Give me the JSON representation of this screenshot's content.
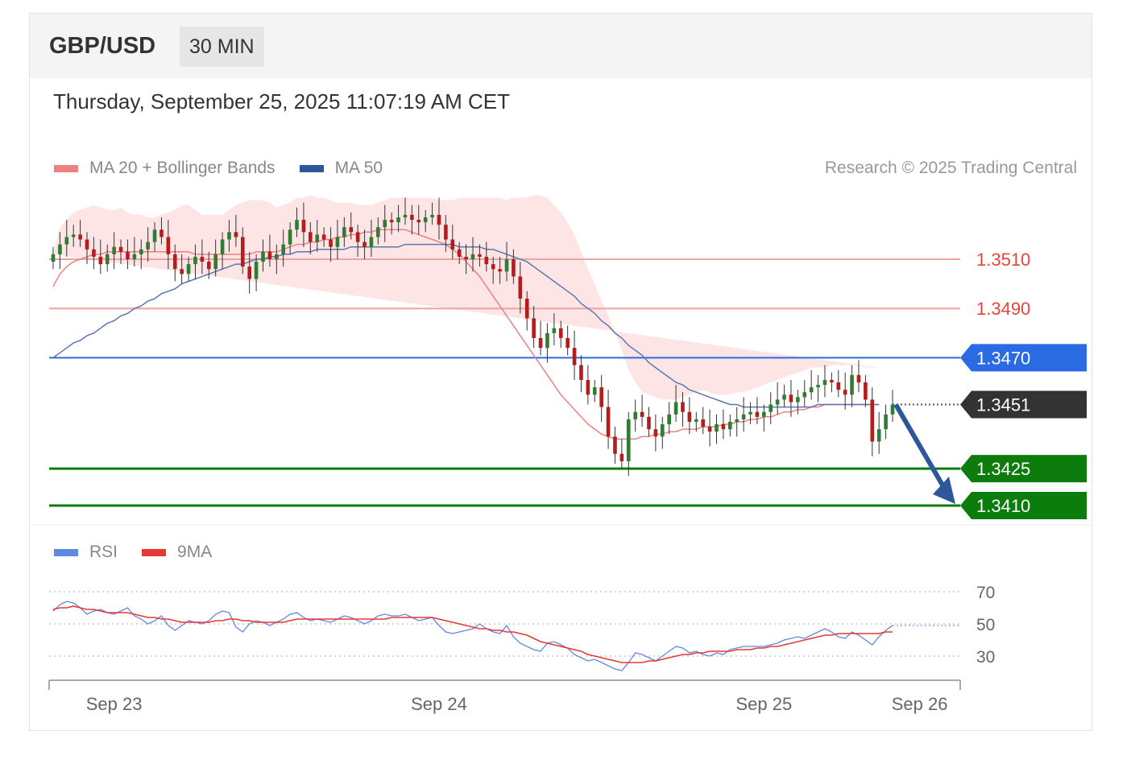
{
  "header": {
    "pair": "GBP/USD",
    "timeframe": "30 MIN"
  },
  "datetime": "Thursday, September 25, 2025 11:07:19 AM CET",
  "legend": {
    "ma20_bb": "MA 20 + Bollinger Bands",
    "ma50": "MA 50",
    "rsi": "RSI",
    "rsi_ma": "9MA"
  },
  "copyright": "Research © 2025 Trading Central",
  "colors": {
    "band_fill": "#fde0e0",
    "ma20": "#f08080",
    "ma50": "#5a77b0",
    "up": "#2e7d32",
    "down": "#b71c1c",
    "resistance": "#e8443a",
    "pivot": "#2a6be4",
    "support": "#0c7d0c",
    "last": "#333333",
    "arrow": "#2c5899",
    "rsi": "#6088e0",
    "rsi_ma": "#e53935"
  },
  "chart_data": {
    "type": "candlestick",
    "ylim": [
      1.3395,
      1.3545
    ],
    "x_labels": [
      {
        "label": "Sep 23",
        "index": 9
      },
      {
        "label": "Sep 24",
        "index": 57
      },
      {
        "label": "Sep 25",
        "index": 105
      },
      {
        "label": "Sep 26",
        "index": 128
      }
    ],
    "levels": [
      {
        "value": 1.351,
        "label": "1.3510",
        "kind": "resistance"
      },
      {
        "value": 1.349,
        "label": "1.3490",
        "kind": "resistance"
      },
      {
        "value": 1.347,
        "label": "1.3470",
        "kind": "pivot"
      },
      {
        "value": 1.3451,
        "label": "1.3451",
        "kind": "last"
      },
      {
        "value": 1.3425,
        "label": "1.3425",
        "kind": "support"
      },
      {
        "value": 1.341,
        "label": "1.3410",
        "kind": "support"
      }
    ],
    "forecast_target": 1.341,
    "closes": [
      1.3512,
      1.3516,
      1.3519,
      1.352,
      1.3518,
      1.3514,
      1.3511,
      1.3508,
      1.3512,
      1.3515,
      1.3513,
      1.351,
      1.3512,
      1.3514,
      1.3517,
      1.3522,
      1.3519,
      1.3512,
      1.3506,
      1.3504,
      1.3508,
      1.3511,
      1.3509,
      1.3506,
      1.3512,
      1.3518,
      1.3521,
      1.3519,
      1.3507,
      1.3502,
      1.3509,
      1.3513,
      1.351,
      1.3512,
      1.3516,
      1.3522,
      1.3526,
      1.3521,
      1.3517,
      1.352,
      1.3518,
      1.3515,
      1.3519,
      1.3523,
      1.3521,
      1.3517,
      1.3515,
      1.3519,
      1.3523,
      1.3526,
      1.3525,
      1.3527,
      1.3528,
      1.3526,
      1.3525,
      1.3527,
      1.3528,
      1.3524,
      1.3518,
      1.3514,
      1.3511,
      1.351,
      1.3512,
      1.3511,
      1.3508,
      1.3506,
      1.3505,
      1.351,
      1.3503,
      1.3494,
      1.3486,
      1.3478,
      1.3474,
      1.348,
      1.3482,
      1.3478,
      1.3474,
      1.3467,
      1.3461,
      1.3455,
      1.3458,
      1.345,
      1.3438,
      1.3431,
      1.3428,
      1.3445,
      1.3448,
      1.3446,
      1.3441,
      1.3438,
      1.3443,
      1.3447,
      1.3452,
      1.3448,
      1.3444,
      1.3445,
      1.3442,
      1.344,
      1.3443,
      1.3441,
      1.3444,
      1.3445,
      1.3447,
      1.3448,
      1.3446,
      1.3448,
      1.3451,
      1.3453,
      1.3455,
      1.3452,
      1.3454,
      1.3456,
      1.3458,
      1.3459,
      1.3461,
      1.346,
      1.3457,
      1.3455,
      1.3463,
      1.346,
      1.3453,
      1.3436,
      1.3441,
      1.3447,
      1.3451
    ],
    "bollinger": {
      "upper": [
        1.3512,
        1.3523,
        1.3526,
        1.3529,
        1.353,
        1.3531,
        1.3532,
        1.3531,
        1.353,
        1.353,
        1.3531,
        1.3529,
        1.3528,
        1.3528,
        1.3527,
        1.3527,
        1.3528,
        1.3529,
        1.353,
        1.3532,
        1.3532,
        1.353,
        1.3528,
        1.3528,
        1.3528,
        1.3528,
        1.353,
        1.3532,
        1.3533,
        1.3534,
        1.3534,
        1.3534,
        1.3533,
        1.3531,
        1.3532,
        1.3533,
        1.3535,
        1.3535,
        1.3536,
        1.3535,
        1.3535,
        1.3534,
        1.3533,
        1.3533,
        1.3533,
        1.3532,
        1.3532,
        1.3532,
        1.3533,
        1.3534,
        1.3535,
        1.3535,
        1.3535,
        1.3535,
        1.3535,
        1.3535,
        1.3535,
        1.3534,
        1.3534,
        1.3534,
        1.3535,
        1.3535,
        1.3535,
        1.3535,
        1.3535,
        1.3535,
        1.3535,
        1.3534,
        1.3535,
        1.3535,
        1.3535,
        1.3536,
        1.3536,
        1.3535,
        1.3532,
        1.3529,
        1.3525,
        1.352,
        1.3513,
        1.3506,
        1.35,
        1.3493,
        1.3487,
        1.348,
        1.3473,
        1.3465,
        1.346,
        1.3456,
        1.3455,
        1.3454,
        1.3453,
        1.3453,
        1.3453,
        1.3454,
        1.3455,
        1.3456,
        1.3457,
        1.3456,
        1.3455,
        1.3455,
        1.3455,
        1.3456,
        1.3456,
        1.3457,
        1.3458,
        1.3459,
        1.346,
        1.3461,
        1.3462,
        1.3463,
        1.3464,
        1.3465,
        1.3466,
        1.3466,
        1.3466,
        1.3467,
        1.3467,
        1.3467,
        1.3467,
        1.3467,
        1.3466,
        1.3466,
        1.3466
      ],
      "lower": [
        1.349,
        1.3494,
        1.3496,
        1.3498,
        1.35,
        1.3501,
        1.3502,
        1.3502,
        1.3503,
        1.3503,
        1.3503,
        1.3502,
        1.3501,
        1.35,
        1.3499,
        1.3497,
        1.3497,
        1.3497,
        1.3496,
        1.3496,
        1.3495,
        1.3495,
        1.3495,
        1.3495,
        1.3495,
        1.3496,
        1.3496,
        1.3496,
        1.3497,
        1.3497,
        1.3497,
        1.3498,
        1.3498,
        1.3499,
        1.35,
        1.3502,
        1.3502,
        1.3502,
        1.3502,
        1.3503,
        1.3504,
        1.3505,
        1.3506,
        1.3507,
        1.3508,
        1.3509,
        1.351,
        1.3511,
        1.3511,
        1.3512,
        1.3512,
        1.3512,
        1.3512,
        1.3511,
        1.3508,
        1.3505,
        1.3502,
        1.35,
        1.3497,
        1.3493,
        1.3489,
        1.3485,
        1.348,
        1.3474,
        1.3468,
        1.3462,
        1.3456,
        1.3451,
        1.3447,
        1.3442,
        1.3437,
        1.3432,
        1.3427,
        1.3423,
        1.342,
        1.3418,
        1.3416,
        1.3415,
        1.3415,
        1.3415,
        1.3415,
        1.3415,
        1.3415,
        1.3416,
        1.3417,
        1.3418,
        1.3419,
        1.342,
        1.3421,
        1.3423,
        1.3424,
        1.3425,
        1.3426,
        1.3426,
        1.3427,
        1.3427,
        1.3428,
        1.3429,
        1.343,
        1.3431,
        1.3432,
        1.3432,
        1.3433,
        1.3433,
        1.3434,
        1.3434,
        1.3434,
        1.3435,
        1.3435,
        1.3435,
        1.3436,
        1.3436,
        1.3436,
        1.3436,
        1.3436,
        1.3436,
        1.3436,
        1.3436,
        1.3436,
        1.3436,
        1.3436,
        1.3436,
        1.3436
      ]
    },
    "ma20": [
      1.3499,
      1.3504,
      1.3507,
      1.3509,
      1.351,
      1.3511,
      1.3512,
      1.3512,
      1.3513,
      1.3513,
      1.3513,
      1.3513,
      1.3513,
      1.3513,
      1.3513,
      1.3513,
      1.3513,
      1.3513,
      1.3513,
      1.3513,
      1.3513,
      1.3512,
      1.3512,
      1.3512,
      1.3512,
      1.3512,
      1.3512,
      1.3512,
      1.3512,
      1.3512,
      1.3513,
      1.3513,
      1.3513,
      1.3513,
      1.3514,
      1.3515,
      1.3516,
      1.3516,
      1.3517,
      1.3517,
      1.3518,
      1.3518,
      1.3519,
      1.3519,
      1.352,
      1.352,
      1.3521,
      1.3521,
      1.3522,
      1.3522,
      1.3522,
      1.3522,
      1.3522,
      1.3521,
      1.352,
      1.3519,
      1.3518,
      1.3517,
      1.3516,
      1.3514,
      1.3512,
      1.3509,
      1.3506,
      1.3503,
      1.3499,
      1.3495,
      1.3491,
      1.3487,
      1.3483,
      1.3479,
      1.3475,
      1.3471,
      1.3467,
      1.3463,
      1.3459,
      1.3455,
      1.3452,
      1.3449,
      1.3446,
      1.3443,
      1.3441,
      1.3439,
      1.3438,
      1.3437,
      1.3437,
      1.3437,
      1.3437,
      1.3438,
      1.3438,
      1.3439,
      1.3439,
      1.344,
      1.344,
      1.3441,
      1.3441,
      1.3441,
      1.3442,
      1.3442,
      1.3442,
      1.3443,
      1.3443,
      1.3444,
      1.3444,
      1.3445,
      1.3445,
      1.3446,
      1.3446,
      1.3447,
      1.3448,
      1.3448,
      1.3449,
      1.3449,
      1.345,
      1.345,
      1.3451,
      1.3451,
      1.3451,
      1.3451,
      1.3451,
      1.3451,
      1.3451,
      1.3451,
      1.3451
    ],
    "ma50": [
      1.347,
      1.3472,
      1.3474,
      1.3476,
      1.3477,
      1.3479,
      1.348,
      1.3482,
      1.3484,
      1.3485,
      1.3487,
      1.3488,
      1.349,
      1.3491,
      1.3493,
      1.3494,
      1.3496,
      1.3497,
      1.3498,
      1.35,
      1.3501,
      1.3502,
      1.3503,
      1.3504,
      1.3505,
      1.3506,
      1.3507,
      1.3508,
      1.3508,
      1.3509,
      1.351,
      1.351,
      1.3511,
      1.3511,
      1.3512,
      1.3512,
      1.3513,
      1.3513,
      1.3513,
      1.3514,
      1.3514,
      1.3514,
      1.3514,
      1.3514,
      1.3515,
      1.3515,
      1.3515,
      1.3515,
      1.3515,
      1.3515,
      1.3515,
      1.3515,
      1.3516,
      1.3516,
      1.3516,
      1.3516,
      1.3516,
      1.3516,
      1.3516,
      1.3516,
      1.3515,
      1.3515,
      1.3515,
      1.3515,
      1.3514,
      1.3514,
      1.3513,
      1.3512,
      1.3511,
      1.351,
      1.3509,
      1.3507,
      1.3505,
      1.3503,
      1.3501,
      1.3499,
      1.3497,
      1.3495,
      1.3492,
      1.349,
      1.3488,
      1.3485,
      1.3483,
      1.348,
      1.3478,
      1.3475,
      1.3473,
      1.3471,
      1.3468,
      1.3466,
      1.3464,
      1.3462,
      1.346,
      1.3459,
      1.3457,
      1.3456,
      1.3455,
      1.3454,
      1.3453,
      1.3452,
      1.3451,
      1.3451,
      1.345,
      1.345,
      1.345,
      1.345,
      1.345,
      1.345,
      1.345,
      1.345,
      1.345,
      1.345,
      1.345,
      1.3451,
      1.3451,
      1.3451,
      1.3451,
      1.3451,
      1.3451,
      1.3451,
      1.3451,
      1.3451,
      1.3451
    ],
    "rsi": {
      "ticks": [
        70,
        50,
        30
      ],
      "ylim": [
        15,
        75
      ],
      "last": 49,
      "rsi": [
        58,
        62,
        64,
        63,
        60,
        56,
        58,
        59,
        57,
        56,
        58,
        60,
        55,
        53,
        50,
        52,
        55,
        49,
        46,
        49,
        52,
        51,
        50,
        52,
        56,
        58,
        57,
        48,
        45,
        50,
        52,
        51,
        49,
        51,
        53,
        56,
        57,
        54,
        52,
        53,
        52,
        51,
        53,
        55,
        54,
        52,
        50,
        52,
        55,
        56,
        55,
        55,
        56,
        54,
        52,
        53,
        54,
        49,
        45,
        44,
        45,
        46,
        47,
        50,
        47,
        45,
        44,
        49,
        42,
        38,
        36,
        34,
        33,
        38,
        39,
        37,
        35,
        31,
        29,
        27,
        28,
        26,
        24,
        22,
        21,
        26,
        32,
        31,
        29,
        27,
        30,
        33,
        36,
        35,
        32,
        33,
        31,
        30,
        32,
        31,
        34,
        35,
        36,
        36,
        36,
        36,
        37,
        38,
        40,
        41,
        42,
        41,
        43,
        45,
        47,
        45,
        42,
        41,
        45,
        43,
        40,
        37,
        42,
        46,
        49
      ],
      "ma9": [
        59,
        60,
        60,
        61,
        60,
        59,
        59,
        58,
        57,
        57,
        57,
        57,
        56,
        55,
        54,
        54,
        53,
        53,
        52,
        51,
        51,
        51,
        51,
        51,
        52,
        52,
        53,
        53,
        52,
        52,
        51,
        51,
        51,
        51,
        51,
        52,
        53,
        53,
        53,
        53,
        53,
        53,
        53,
        53,
        53,
        53,
        53,
        53,
        53,
        53,
        54,
        54,
        54,
        54,
        54,
        54,
        54,
        53,
        52,
        51,
        50,
        49,
        48,
        47,
        47,
        46,
        46,
        45,
        45,
        44,
        43,
        41,
        39,
        38,
        37,
        36,
        35,
        34,
        33,
        31,
        30,
        29,
        28,
        27,
        26,
        26,
        26,
        26,
        27,
        27,
        28,
        29,
        30,
        31,
        31,
        32,
        32,
        33,
        33,
        33,
        33,
        34,
        34,
        34,
        35,
        35,
        36,
        36,
        37,
        38,
        39,
        40,
        41,
        42,
        43,
        43,
        44,
        44,
        44,
        44,
        44,
        44,
        44,
        45,
        45
      ]
    }
  }
}
